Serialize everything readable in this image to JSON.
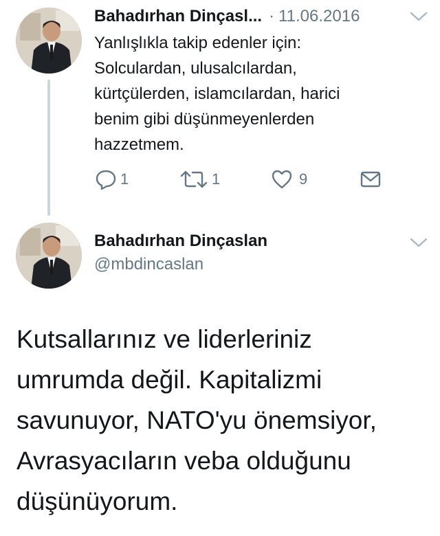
{
  "reply_tweet": {
    "author_name": "Bahadırhan Dinçasl...",
    "separator": "·",
    "date": "11.06.2016",
    "text_lines": [
      "Yanlışlıkla takip edenler için:",
      "Solculardan, ulusalcılardan,",
      "kürtçülerden, islamcılardan, harici",
      "benim gibi düşünmeyenlerden",
      "hazzetmem."
    ],
    "actions": {
      "reply_count": "1",
      "retweet_count": "1",
      "like_count": "9"
    }
  },
  "main_tweet": {
    "author_name": "Bahadırhan Dinçaslan",
    "handle": "@mbdincaslan",
    "text_lines": [
      "Kutsallarınız ve liderleriniz",
      "umrumda değil. Kapitalizmi",
      "savunuyor, NATO'yu önemsiyor,",
      "Avrasyacıların veba olduğunu",
      "düşünüyorum."
    ]
  },
  "colors": {
    "text": "#14171a",
    "secondary": "#657786",
    "thread_line": "#ccd6dd",
    "icon": "#657786"
  },
  "icons": {
    "reply": "reply-icon",
    "retweet": "retweet-icon",
    "like": "heart-icon",
    "dm": "envelope-icon",
    "menu": "chevron-down-icon"
  }
}
